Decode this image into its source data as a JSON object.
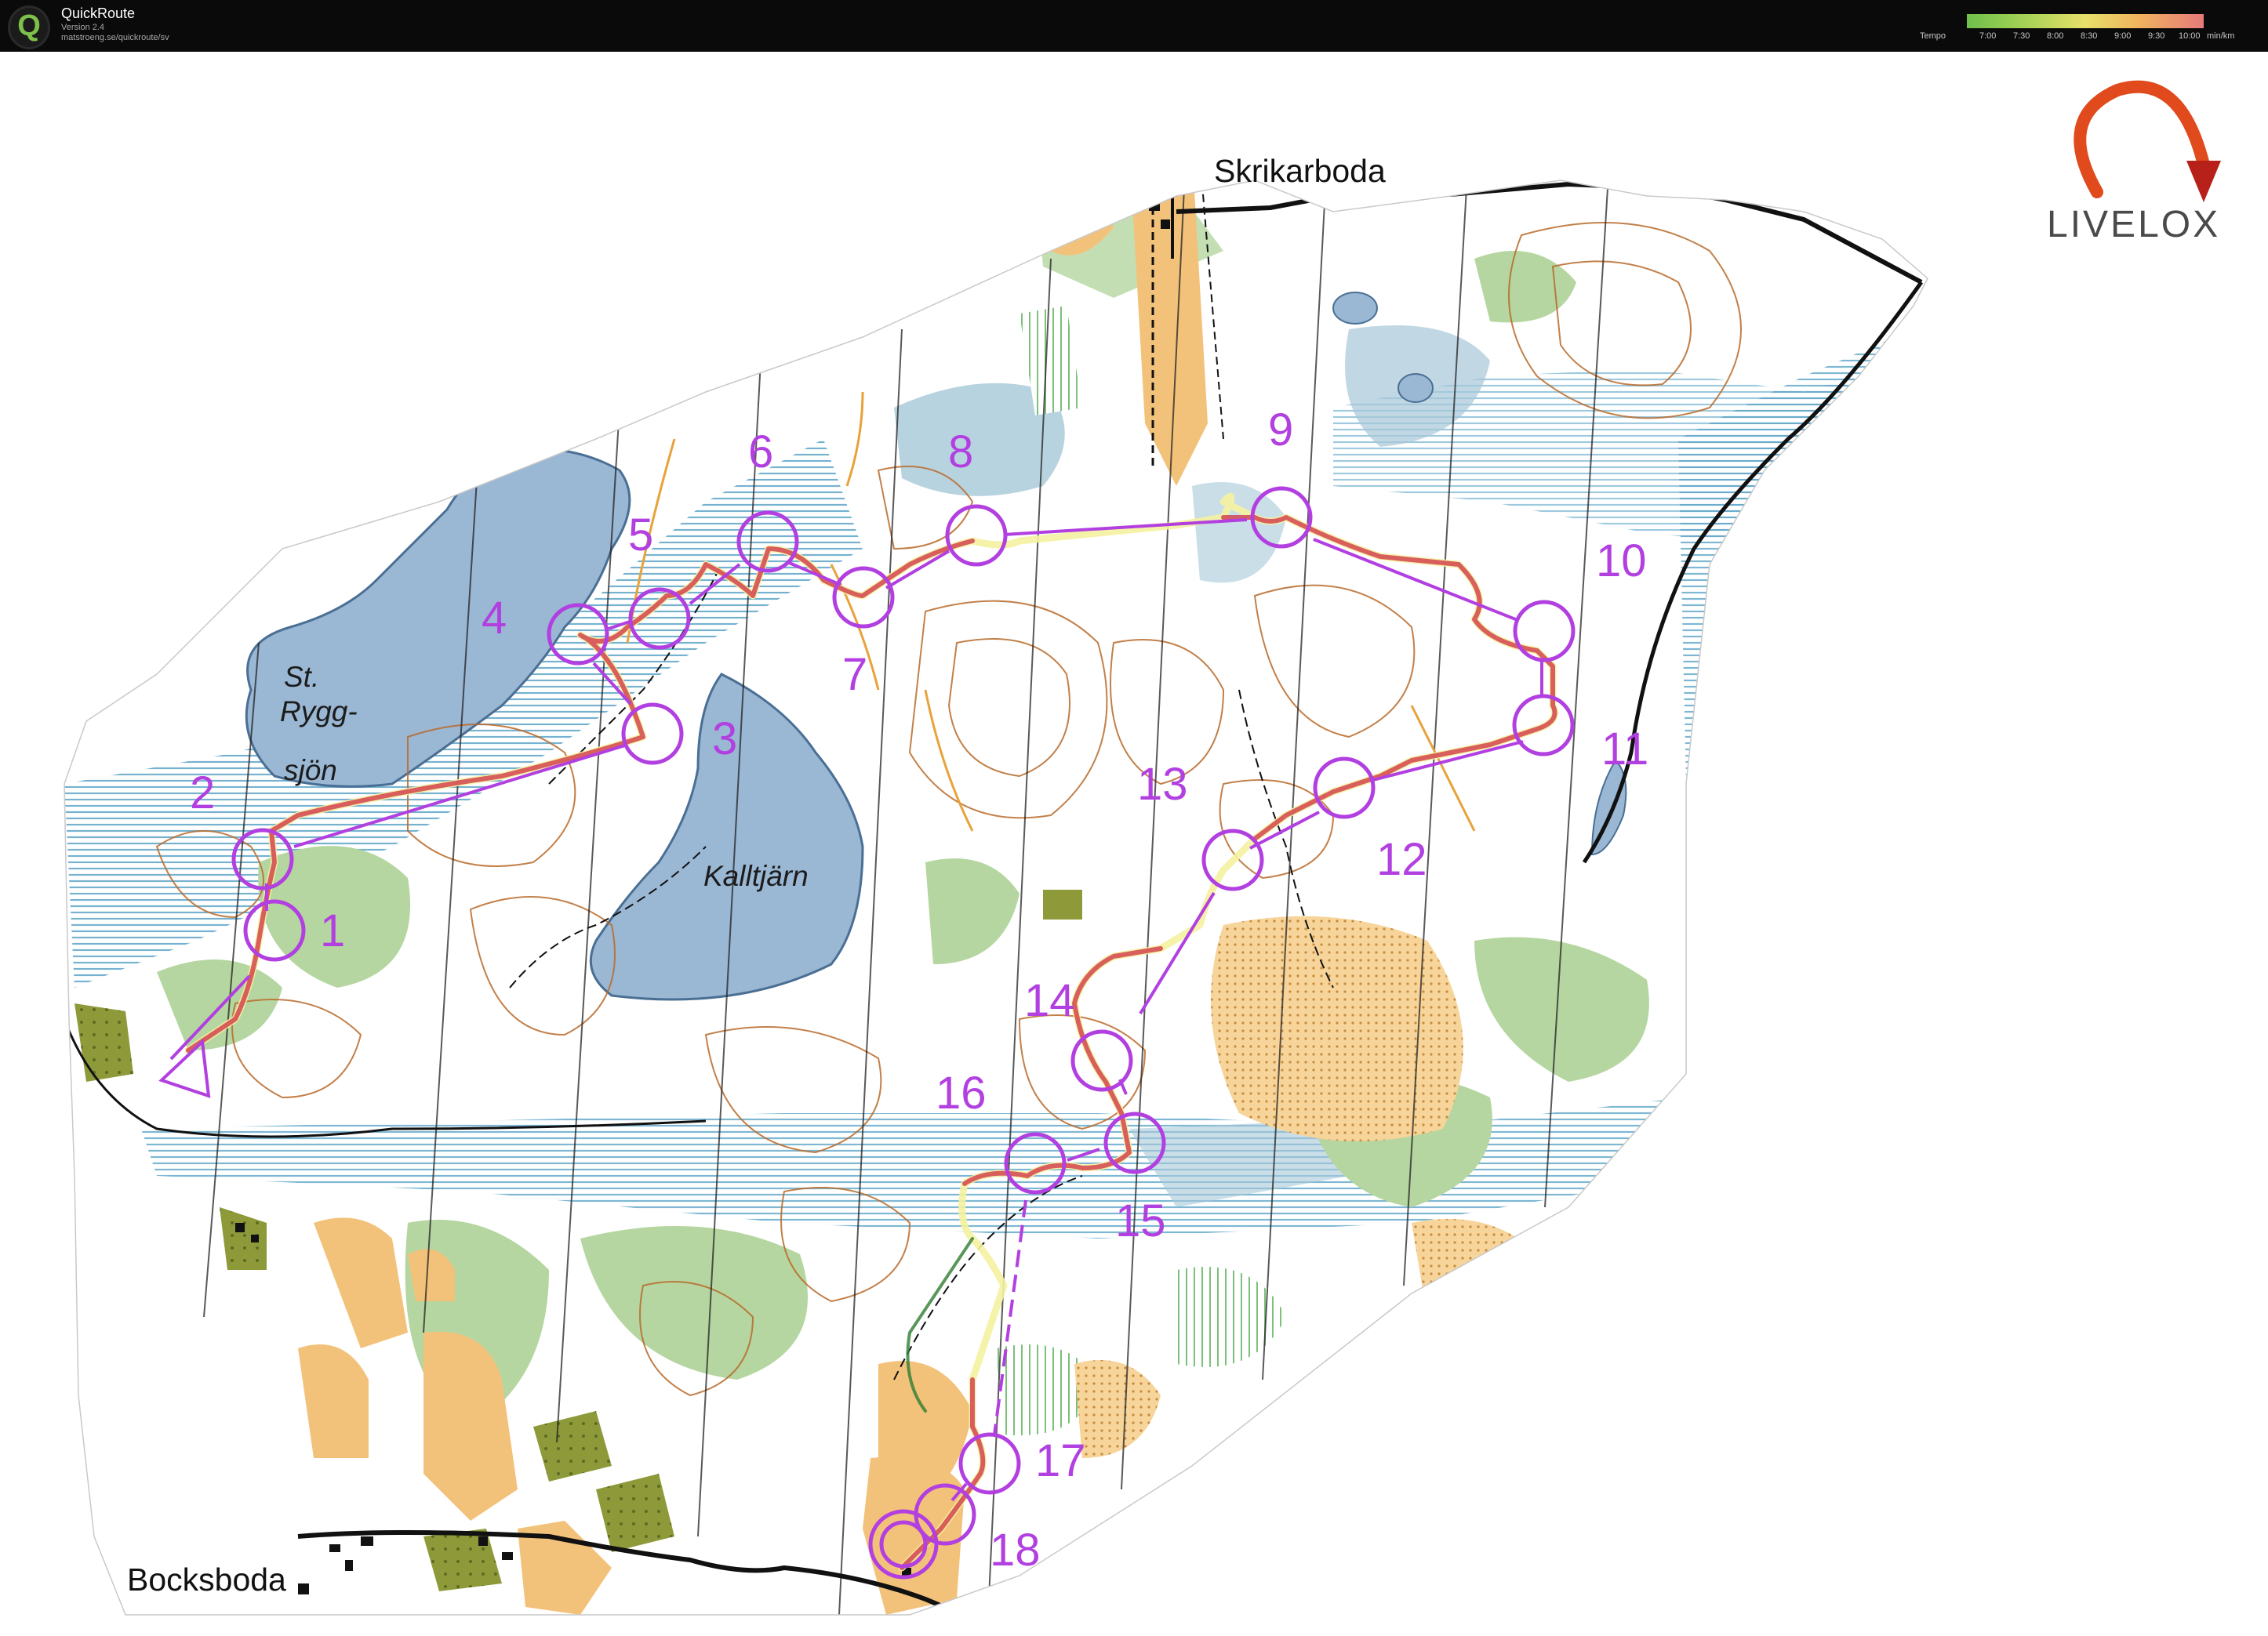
{
  "app": {
    "title": "QuickRoute",
    "version": "Version 2.4",
    "url": "matstroeng.se/quickroute/sv",
    "logo_letter": "Q"
  },
  "tempo": {
    "label": "Tempo",
    "ticks": [
      "7:00",
      "7:30",
      "8:00",
      "8:30",
      "9:00",
      "9:30",
      "10:00"
    ],
    "unit": "min/km",
    "colors": [
      "#6ec04b",
      "#a7d256",
      "#e8e06a",
      "#f0b45e",
      "#e67a7a"
    ]
  },
  "brand": {
    "name": "LIVELOX",
    "colors": [
      "#e04a1c",
      "#b8201a"
    ]
  },
  "places": {
    "north": "Skrikarboda",
    "south": "Bocksboda",
    "lake_big_line1": "St.",
    "lake_big_line2": "Rygg-",
    "lake_big_line3": "sjön",
    "lake_center": "Kalltjärn"
  },
  "course": {
    "color": "#b23fe0",
    "route_color": "#d23a4a",
    "start_icon": "start-triangle",
    "finish_icon": "finish-double-circle",
    "controls": [
      "1",
      "2",
      "3",
      "4",
      "5",
      "6",
      "7",
      "8",
      "9",
      "10",
      "11",
      "12",
      "13",
      "14",
      "15",
      "16",
      "17",
      "18"
    ]
  },
  "map_colors": {
    "open": "#f3c27a",
    "water": "#9ab7d4",
    "marsh": "#7fb2c8",
    "vegetation": "#b5d6a0",
    "contour": "#b86a2a",
    "fields": "#8e9a3a"
  }
}
